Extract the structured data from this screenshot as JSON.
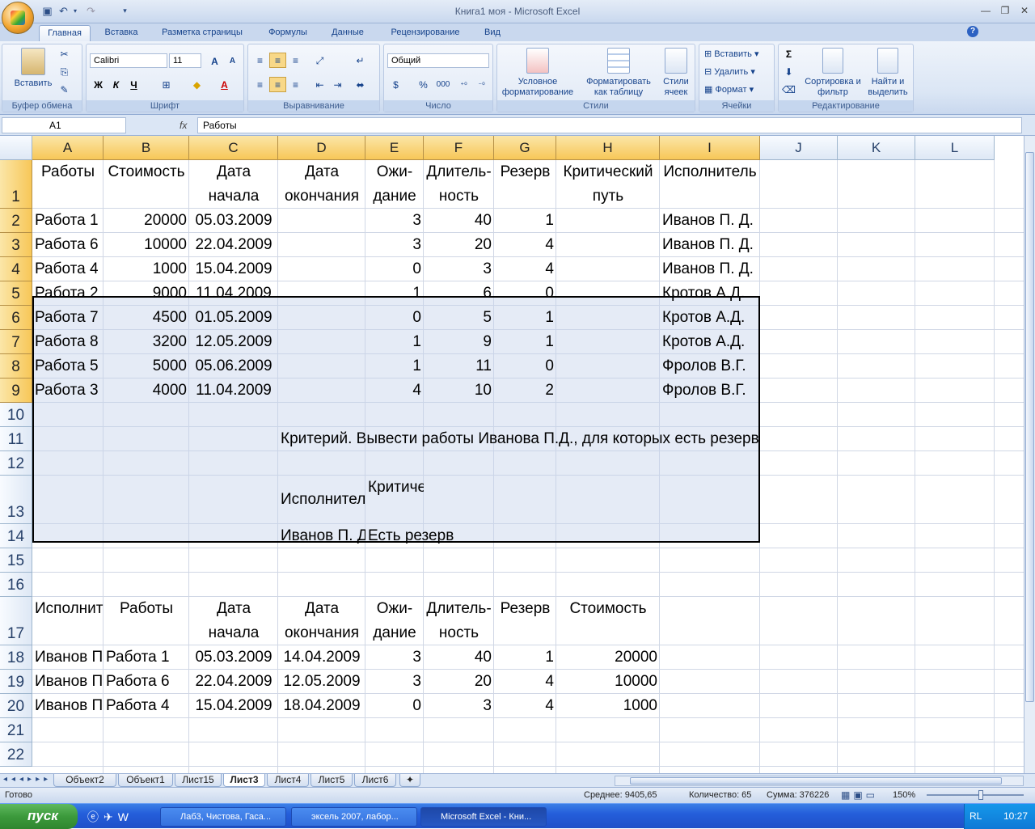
{
  "window": {
    "title": "Книга1 моя - Microsoft Excel"
  },
  "ribbon_tabs": [
    "Главная",
    "Вставка",
    "Разметка страницы",
    "Формулы",
    "Данные",
    "Рецензирование",
    "Вид"
  ],
  "ribbon": {
    "clipboard": {
      "label": "Буфер обмена",
      "paste": "Вставить"
    },
    "font": {
      "label": "Шрифт",
      "name": "Calibri",
      "size": "11",
      "bold": "Ж",
      "italic": "К",
      "underline": "Ч"
    },
    "align": {
      "label": "Выравнивание"
    },
    "number": {
      "label": "Число",
      "format": "Общий",
      "percent": "%",
      "thousands": "000"
    },
    "styles": {
      "label": "Стили",
      "cond": "Условное форматирование",
      "astable": "Форматировать как таблицу",
      "cellstyles": "Стили ячеек"
    },
    "cells": {
      "label": "Ячейки",
      "insert": "Вставить",
      "delete": "Удалить",
      "format": "Формат"
    },
    "editing": {
      "label": "Редактирование",
      "sort": "Сортировка и фильтр",
      "find": "Найти и выделить"
    }
  },
  "formula_bar": {
    "namebox": "A1",
    "fx": "fx",
    "formula": "Работы"
  },
  "columns": [
    "A",
    "B",
    "C",
    "D",
    "E",
    "F",
    "G",
    "H",
    "I",
    "J",
    "K",
    "L"
  ],
  "rows": [
    "1",
    "2",
    "3",
    "4",
    "5",
    "6",
    "7",
    "8",
    "9",
    "10",
    "11",
    "12",
    "13",
    "14",
    "15",
    "16",
    "17",
    "18",
    "19",
    "20",
    "21",
    "22"
  ],
  "table_headers": {
    "a": "Работы",
    "b": "Стоимость",
    "c": "Дата начала",
    "d": "Дата окончания",
    "e": "Ожи-дание",
    "f": "Длитель-ность",
    "g": "Резерв",
    "h": "Критический путь",
    "i": "Исполнитель"
  },
  "table_rows": [
    {
      "a": "Работа 1",
      "b": "20000",
      "c": "05.03.2009",
      "e": "3",
      "f": "40",
      "g": "1",
      "i": "Иванов П. Д."
    },
    {
      "a": "Работа 6",
      "b": "10000",
      "c": "22.04.2009",
      "e": "3",
      "f": "20",
      "g": "4",
      "i": "Иванов П. Д."
    },
    {
      "a": "Работа 4",
      "b": "1000",
      "c": "15.04.2009",
      "e": "0",
      "f": "3",
      "g": "4",
      "i": "Иванов П. Д."
    },
    {
      "a": "Работа 2",
      "b": "9000",
      "c": "11.04.2009",
      "e": "1",
      "f": "6",
      "g": "0",
      "i": "Кротов А.Д."
    },
    {
      "a": "Работа 7",
      "b": "4500",
      "c": "01.05.2009",
      "e": "0",
      "f": "5",
      "g": "1",
      "i": "Кротов А.Д."
    },
    {
      "a": "Работа 8",
      "b": "3200",
      "c": "12.05.2009",
      "e": "1",
      "f": "9",
      "g": "1",
      "i": "Кротов А.Д."
    },
    {
      "a": "Работа 5",
      "b": "5000",
      "c": "05.06.2009",
      "e": "1",
      "f": "11",
      "g": "0",
      "i": "Фролов В.Г."
    },
    {
      "a": "Работа 3",
      "b": "4000",
      "c": "11.04.2009",
      "e": "4",
      "f": "10",
      "g": "2",
      "i": "Фролов В.Г."
    }
  ],
  "criterion_text": "Критерий. Вывести работы Иванова П.Д., для которых есть резерв",
  "criteria": {
    "h1": "Исполнитель",
    "h2": "Критический",
    "v1": "Иванов П. Д.",
    "v2": "Есть резерв"
  },
  "result_headers": {
    "a": "Исполнитель",
    "b": "Работы",
    "c": "Дата начала",
    "d": "Дата окончания",
    "e": "Ожи-дание",
    "f": "Длитель-ность",
    "g": "Резерв",
    "h": "Стоимость"
  },
  "result_rows": [
    {
      "a": "Иванов П. Д.",
      "b": "Работа 1",
      "c": "05.03.2009",
      "d": "14.04.2009",
      "e": "3",
      "f": "40",
      "g": "1",
      "h": "20000"
    },
    {
      "a": "Иванов П. Д.",
      "b": "Работа 6",
      "c": "22.04.2009",
      "d": "12.05.2009",
      "e": "3",
      "f": "20",
      "g": "4",
      "h": "10000"
    },
    {
      "a": "Иванов П. Д.",
      "b": "Работа 4",
      "c": "15.04.2009",
      "d": "18.04.2009",
      "e": "0",
      "f": "3",
      "g": "4",
      "h": "1000"
    }
  ],
  "sheet_tabs": [
    "Объект2",
    "Объект1",
    "Лист15",
    "Лист3",
    "Лист4",
    "Лист5",
    "Лист6"
  ],
  "active_sheet": "Лист3",
  "status": {
    "ready": "Готово",
    "avg": "Среднее: 9405,65",
    "count": "Количество: 65",
    "sum": "Сумма: 376226",
    "zoom": "150%"
  },
  "taskbar": {
    "start": "пуск",
    "tasks": [
      "Лаб3, Чистова, Гаса...",
      "эксель 2007, лабор...",
      "Microsoft Excel - Кни..."
    ],
    "lang": "RL",
    "time": "10:27"
  }
}
